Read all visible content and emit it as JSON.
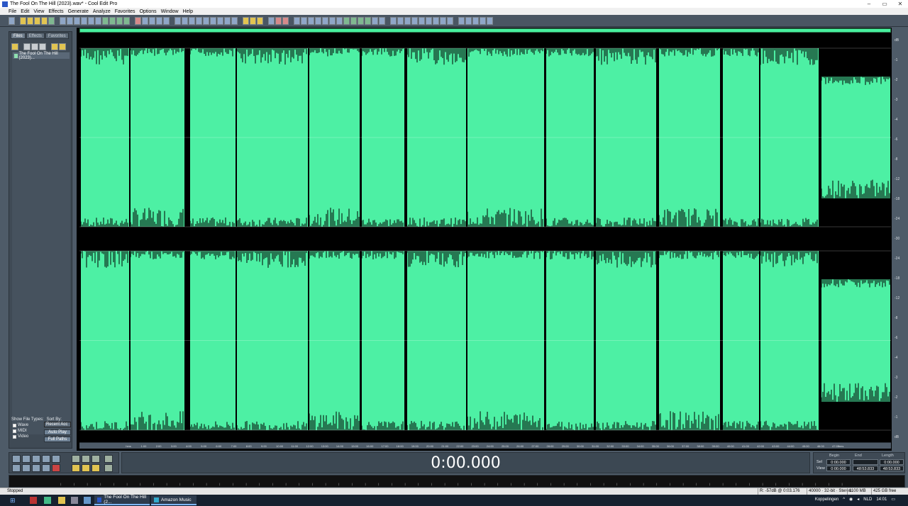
{
  "window": {
    "title": "The Fool On The Hill (2023).wav* - Cool Edit Pro"
  },
  "menu": [
    "File",
    "Edit",
    "View",
    "Effects",
    "Generate",
    "Analyze",
    "Favorites",
    "Options",
    "Window",
    "Help"
  ],
  "sidebar": {
    "tabs": [
      "Files",
      "Effects",
      "Favorites"
    ],
    "files": [
      "The Fool On The Hill (2023)..."
    ],
    "show_types_label": "Show File Types:",
    "sort_label": "Sort By:",
    "types": [
      "Wave",
      "MIDI",
      "Video"
    ],
    "sort_value": "Recent Acc",
    "auto_play": "Auto Play",
    "full_paths": "Full Paths"
  },
  "timeline": {
    "start_label": "hms",
    "labels": [
      "1:00",
      "2:00",
      "3:00",
      "4:00",
      "5:00",
      "6:00",
      "7:00",
      "8:00",
      "9:00",
      "10:00",
      "11:00",
      "12:00",
      "13:00",
      "14:00",
      "15:00",
      "16:00",
      "17:00",
      "18:00",
      "19:00",
      "20:00",
      "21:00",
      "22:00",
      "23:00",
      "24:00",
      "25:00",
      "26:00",
      "27:00",
      "28:00",
      "29:00",
      "30:00",
      "31:00",
      "32:00",
      "33:00",
      "34:00",
      "35:00",
      "36:00",
      "37:00",
      "38:00",
      "39:00",
      "40:00",
      "41:00",
      "42:00",
      "43:00",
      "44:00",
      "45:00",
      "46:00",
      "47:00"
    ],
    "end_label": "hms"
  },
  "db_scale": [
    "dB",
    "-1",
    "-2",
    "-3",
    "-4",
    "-6",
    "-8",
    "-12",
    "-18",
    "-24",
    "-30",
    "-24",
    "-18",
    "-12",
    "-8",
    "-6",
    "-4",
    "-3",
    "-2",
    "-1",
    "dB"
  ],
  "transport": {
    "time": "0:00.000"
  },
  "selection": {
    "headers": [
      "Begin",
      "End",
      "Length"
    ],
    "sel_label": "Sel",
    "view_label": "View",
    "sel": [
      "0:00.000",
      "",
      "0:00.000"
    ],
    "view": [
      "0:00.000",
      "48:53.833",
      "48:53.833"
    ]
  },
  "status": {
    "left": "Stopped",
    "items": [
      "R: -57dB @ 0:03.176",
      "40000 · 32-bit · Stereo",
      "1100 MB",
      "425 GB free"
    ]
  },
  "taskbar": {
    "apps": [
      "The Fool On The Hill (2...",
      "Amazon Music"
    ],
    "tray_text": "Koppelingen",
    "lang": "NLD",
    "clock": "14:01"
  },
  "colors": {
    "wave": "#4df0a4",
    "background": "#000000",
    "panel": "#4e5b68"
  }
}
